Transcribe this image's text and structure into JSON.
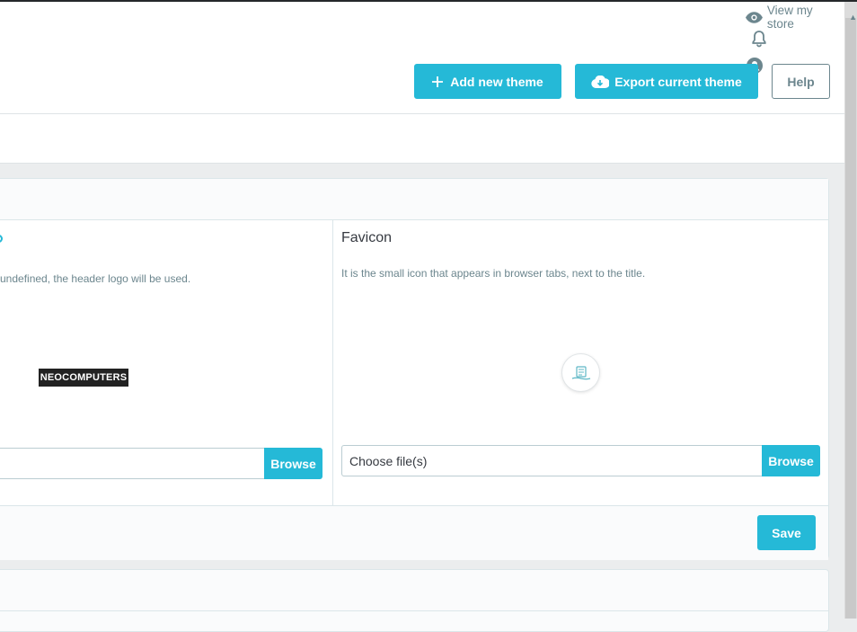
{
  "header": {
    "view_store": "View my store",
    "add_theme": "Add new theme",
    "export_theme": "Export current theme",
    "help": "Help",
    "icons": {
      "view_store": "eye-icon",
      "notifications": "bell-icon",
      "user": "user-icon",
      "add": "plus-icon",
      "export": "cloud-download-icon"
    }
  },
  "logo_section": {
    "description": "undefined, the header logo will be used.",
    "logo_text": "NEOCOMPUTERS",
    "browse": "Browse"
  },
  "favicon_section": {
    "title": "Favicon",
    "description": "It is the small icon that appears in browser tabs, next to the title.",
    "file_placeholder": "Choose file(s)",
    "browse": "Browse"
  },
  "footer": {
    "save": "Save"
  },
  "colors": {
    "primary": "#25b9d7",
    "muted": "#6c868e",
    "text": "#363a41"
  }
}
